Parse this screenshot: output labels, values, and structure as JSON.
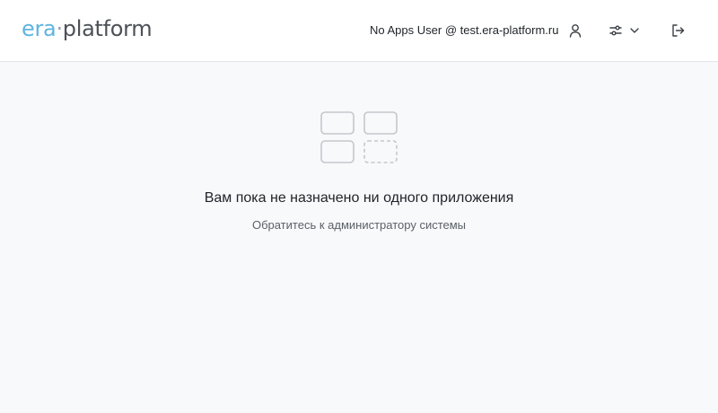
{
  "header": {
    "logo": {
      "part1": "era",
      "separator": "·",
      "part2": "platform"
    },
    "user_label": "No Apps User @ test.era-platform.ru",
    "icons": {
      "user": "user-icon",
      "settings": "sliders-icon",
      "dropdown": "chevron-down-icon",
      "logout": "logout-icon"
    }
  },
  "empty_state": {
    "icon": "app-grid-icon",
    "title": "Вам пока не назначено ни одного приложения",
    "subtitle": "Обратитесь к администратору системы"
  },
  "colors": {
    "logo_accent": "#5fb4e0",
    "logo_text": "#4c5157",
    "background": "#f8f9fb",
    "header_bg": "#ffffff",
    "icon_stroke": "#c4c7cc"
  }
}
